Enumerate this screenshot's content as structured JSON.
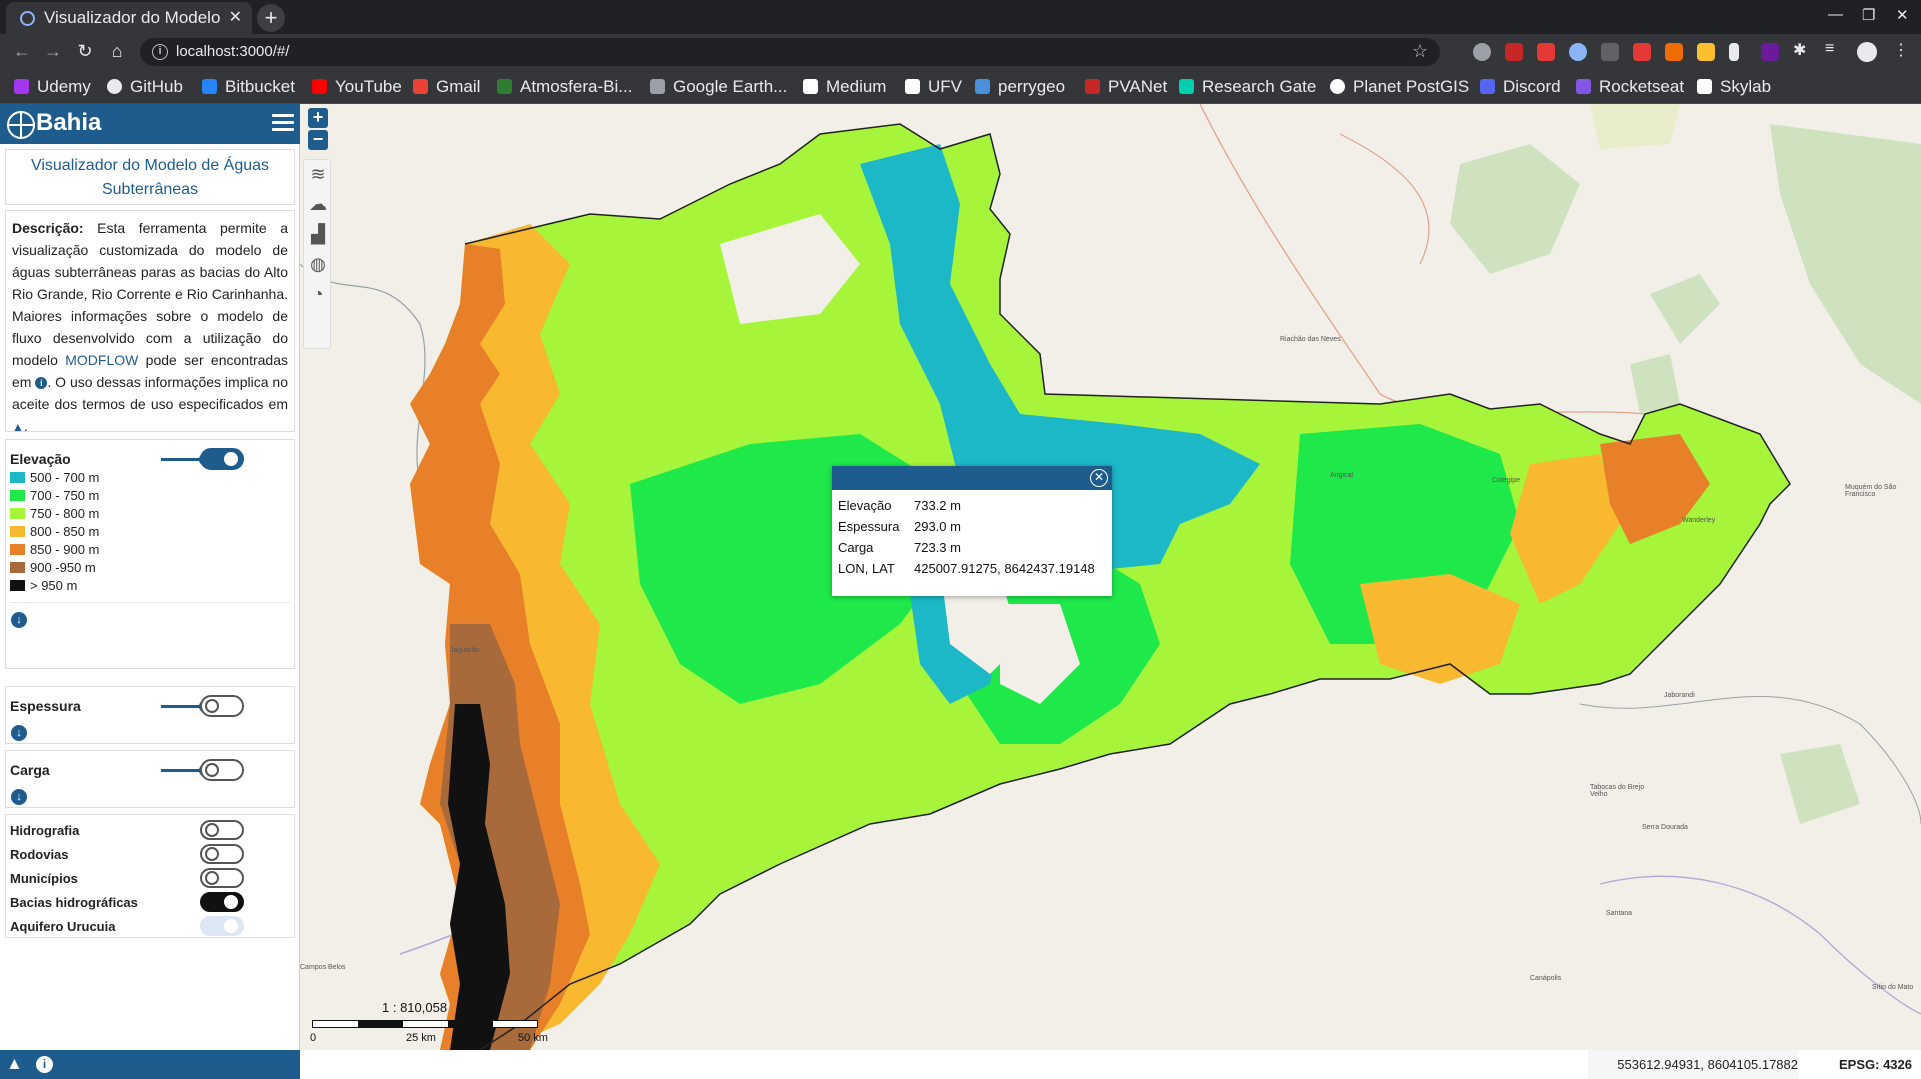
{
  "browser": {
    "tab_title": "Visualizador do Modelo",
    "url": "localhost:3000/#/",
    "bookmarks": [
      {
        "label": "Udemy",
        "color": "#a435f0"
      },
      {
        "label": "GitHub",
        "color": "#e8eaed"
      },
      {
        "label": "Bitbucket",
        "color": "#2684ff"
      },
      {
        "label": "YouTube",
        "color": "#ff0000"
      },
      {
        "label": "Gmail",
        "color": "#ea4335"
      },
      {
        "label": "Atmosfera-Bi...",
        "color": "#2e7d32"
      },
      {
        "label": "Google Earth...",
        "color": "#9aa0a6"
      },
      {
        "label": "Medium",
        "color": "#ffffff"
      },
      {
        "label": "UFV",
        "color": "#ffffff"
      },
      {
        "label": "perrygeo",
        "color": "#4a90d9"
      },
      {
        "label": "PVANet",
        "color": "#c62828"
      },
      {
        "label": "Research Gate",
        "color": "#00d0af"
      },
      {
        "label": "Planet PostGIS",
        "color": "#ffffff"
      },
      {
        "label": "Discord",
        "color": "#5865f2"
      },
      {
        "label": "Rocketseat",
        "color": "#8257e5"
      },
      {
        "label": "Skylab",
        "color": "#ffffff"
      }
    ]
  },
  "app": {
    "brand": "Bahia",
    "title": "Visualizador do Modelo de Águas Subterrâneas",
    "description": {
      "label": "Descrição:",
      "text1": " Esta ferramenta permite a visualização customizada do modelo de águas subterrâneas paras as bacias do Alto Rio Grande, Rio Corrente e Rio Carinhanha. Maiores informações sobre o modelo de fluxo desenvolvido com a utilização do modelo ",
      "link": "MODFLOW",
      "text2": " pode ser encontradas em ",
      "text3": ". O uso dessas informações implica no aceite dos termos de uso especificados em ",
      "text4": "."
    },
    "layers": {
      "elevacao": {
        "label": "Elevação",
        "enabled": true,
        "legend": [
          {
            "label": "500 - 700 m",
            "color": "#1cb8c8"
          },
          {
            "label": "700 - 750 m",
            "color": "#1ee84a"
          },
          {
            "label": "750 - 800 m",
            "color": "#a6f53a"
          },
          {
            "label": "800 - 850 m",
            "color": "#f8b830"
          },
          {
            "label": "850 - 900 m",
            "color": "#e8802a"
          },
          {
            "label": "900 -950 m",
            "color": "#a86a3a"
          },
          {
            "label": "> 950 m",
            "color": "#111111"
          }
        ]
      },
      "espessura": {
        "label": "Espessura",
        "enabled": false
      },
      "carga": {
        "label": "Carga",
        "enabled": false
      }
    },
    "base_layers": [
      {
        "label": "Hidrografia",
        "state": "off"
      },
      {
        "label": "Rodovias",
        "state": "off"
      },
      {
        "label": "Municípios",
        "state": "off"
      },
      {
        "label": "Bacias hidrográficas",
        "state": "on"
      },
      {
        "label": "Aquifero Urucuia",
        "state": "disabled"
      }
    ]
  },
  "map": {
    "popup": {
      "rows": [
        {
          "key": "Elevação",
          "value": "733.2 m"
        },
        {
          "key": "Espessura",
          "value": "293.0 m"
        },
        {
          "key": "Carga",
          "value": "723.3 m"
        },
        {
          "key": "LON, LAT",
          "value": "425007.91275, 8642437.19148"
        }
      ]
    },
    "scale": {
      "ratio": "1 : 810,058",
      "ticks": [
        "0",
        "25 km",
        "50 km"
      ]
    },
    "cursor_coords": "553612.94931, 8604105.17882",
    "epsg": "EPSG: 4326",
    "place_labels": [
      "Riachão das Neves",
      "Angical",
      "Cotegipe",
      "Wanderley",
      "Muquém do São Francisco",
      "Jaguarão",
      "Jaborandi",
      "Tabocas do Brejo Velho",
      "Serra Dourada",
      "Santana",
      "Canápolis",
      "Sítio do Mato",
      "Campos Belos"
    ]
  },
  "zoom": {
    "in": "+",
    "out": "−"
  }
}
